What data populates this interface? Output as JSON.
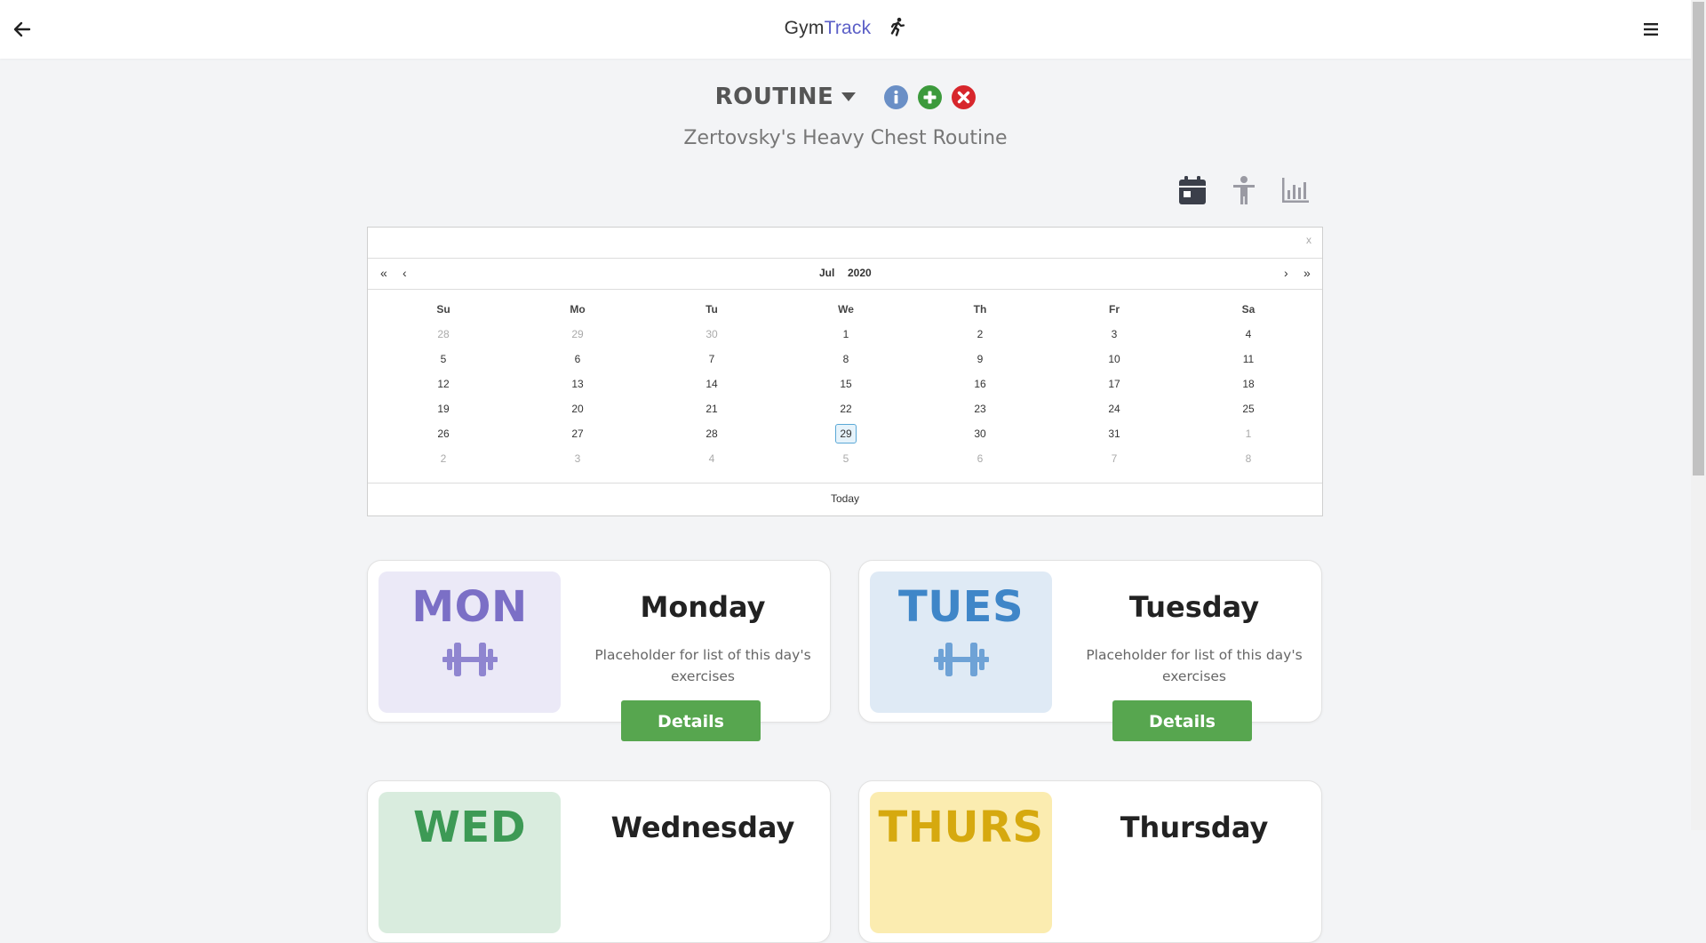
{
  "navbar": {
    "brand_part1": "Gym",
    "brand_part2": "Track",
    "back_icon": "arrow-left-icon",
    "menu_icon": "hamburger-menu-icon",
    "brand_icon": "running-person-icon"
  },
  "routine": {
    "label": "ROUTINE",
    "name": "Zertovsky's Heavy Chest Routine",
    "actions": [
      "info-icon",
      "plus-icon",
      "delete-icon"
    ]
  },
  "views": [
    "calendar-icon",
    "person-icon",
    "bar-chart-icon"
  ],
  "calendar": {
    "close": "x",
    "prev_year": "«",
    "prev_month": "‹",
    "next_month": "›",
    "next_year": "»",
    "month": "Jul",
    "year": "2020",
    "weekdays": [
      "Su",
      "Mo",
      "Tu",
      "We",
      "Th",
      "Fr",
      "Sa"
    ],
    "weeks": [
      [
        "28",
        "29",
        "30",
        "1",
        "2",
        "3",
        "4"
      ],
      [
        "5",
        "6",
        "7",
        "8",
        "9",
        "10",
        "11"
      ],
      [
        "12",
        "13",
        "14",
        "15",
        "16",
        "17",
        "18"
      ],
      [
        "19",
        "20",
        "21",
        "22",
        "23",
        "24",
        "25"
      ],
      [
        "26",
        "27",
        "28",
        "29",
        "30",
        "31",
        "1"
      ],
      [
        "2",
        "3",
        "4",
        "5",
        "6",
        "7",
        "8"
      ]
    ],
    "selected": "29",
    "today_label": "Today"
  },
  "days": [
    {
      "abbr": "MON",
      "title": "Monday",
      "desc": "Placeholder for list of this day's exercises",
      "button": "Details",
      "bg": "#ebe9f7",
      "fg": "#7b6fc6",
      "icon_fg": "#8f85d0",
      "icon": "dumbbell-icon"
    },
    {
      "abbr": "TUES",
      "title": "Tuesday",
      "desc": "Placeholder for list of this day's exercises",
      "button": "Details",
      "bg": "#dfeaf5",
      "fg": "#3f86c8",
      "icon_fg": "#6ea2d6",
      "icon": "dumbbell-icon"
    },
    {
      "abbr": "WED",
      "title": "Wednesday",
      "desc": "",
      "button": "",
      "bg": "#d9ecde",
      "fg": "#3d9a55",
      "icon_fg": "#6ab07f",
      "icon": "dumbbell-icon"
    },
    {
      "abbr": "THURS",
      "title": "Thursday",
      "desc": "",
      "button": "",
      "bg": "#fbecb0",
      "fg": "#d6a90f",
      "icon_fg": "#dcb940",
      "icon": "dumbbell-icon"
    }
  ]
}
